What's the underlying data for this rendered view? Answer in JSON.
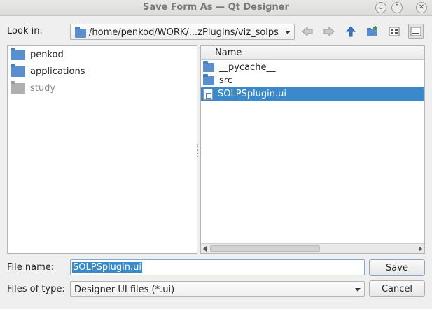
{
  "window": {
    "title": "Save Form As — Qt Designer",
    "controls": {
      "minimize": "⌄",
      "maximize": "⌃",
      "close": "✕"
    }
  },
  "look_in": {
    "label": "Look in:",
    "path": "/home/penkod/WORK/...zPlugins/viz_solps"
  },
  "toolbar": {
    "icons": [
      "back-arrow-icon",
      "forward-arrow-icon",
      "up-arrow-icon",
      "new-folder-icon",
      "list-view-icon",
      "detail-view-icon"
    ]
  },
  "sidebar": {
    "items": [
      {
        "label": "penkod",
        "dimmed": false
      },
      {
        "label": "applications",
        "dimmed": false
      },
      {
        "label": "study",
        "dimmed": true
      }
    ]
  },
  "files": {
    "column_header": "Name",
    "rows": [
      {
        "name": "__pycache__",
        "type": "folder",
        "selected": false
      },
      {
        "name": "src",
        "type": "folder",
        "selected": false
      },
      {
        "name": "SOLPSplugin.ui",
        "type": "file",
        "selected": true
      }
    ]
  },
  "file_name": {
    "label": "File name:",
    "value": "SOLPSplugin.ui"
  },
  "file_type": {
    "label": "Files of type:",
    "value": "Designer UI files (*.ui)"
  },
  "buttons": {
    "save": "Save",
    "cancel": "Cancel"
  }
}
